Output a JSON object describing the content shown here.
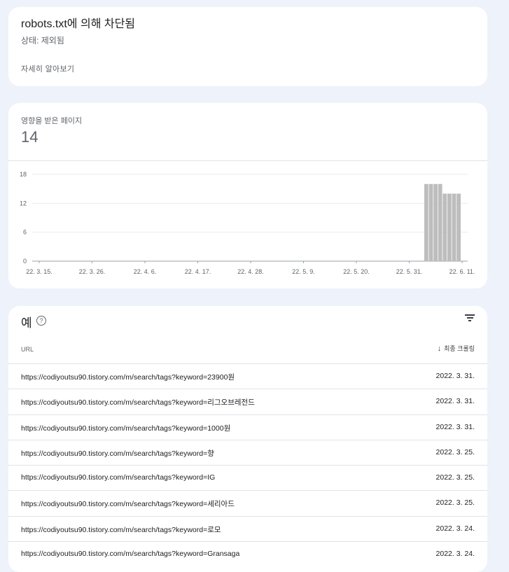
{
  "status_card": {
    "title": "robots.txt에 의해 차단됨",
    "status": "상태: 제외됨",
    "learn_more": "자세히 알아보기"
  },
  "chart_card": {
    "label": "영향을 받은 페이지",
    "count": "14"
  },
  "chart_data": {
    "type": "bar",
    "x_ticks": [
      "22. 3. 15.",
      "22. 3. 26.",
      "22. 4. 6.",
      "22. 4. 17.",
      "22. 4. 28.",
      "22. 5. 9.",
      "22. 5. 20.",
      "22. 5. 31.",
      "22. 6. 11."
    ],
    "y_ticks": [
      0,
      6,
      12,
      18
    ],
    "ylim": [
      0,
      18
    ],
    "bars": [
      {
        "date": "22. 6. 2.",
        "value": 16
      },
      {
        "date": "22. 6. 3.",
        "value": 16
      },
      {
        "date": "22. 6. 4.",
        "value": 16
      },
      {
        "date": "22. 6. 5.",
        "value": 16
      },
      {
        "date": "22. 6. 6.",
        "value": 14
      },
      {
        "date": "22. 6. 7.",
        "value": 14
      },
      {
        "date": "22. 6. 8.",
        "value": 14
      },
      {
        "date": "22. 6. 9.",
        "value": 14
      }
    ],
    "bar_color": "#bdbdbd",
    "grid": true
  },
  "examples": {
    "title": "예",
    "help_icon": "help-icon",
    "filter_icon": "filter-icon",
    "col_url": "URL",
    "col_date": "최종 크롤링",
    "sort_icon": "arrow-down-icon",
    "rows": [
      {
        "url": "https://codiyoutsu90.tistory.com/m/search/tags?keyword=23900원",
        "date": "2022. 3. 31."
      },
      {
        "url": "https://codiyoutsu90.tistory.com/m/search/tags?keyword=리그오브레전드",
        "date": "2022. 3. 31."
      },
      {
        "url": "https://codiyoutsu90.tistory.com/m/search/tags?keyword=1000원",
        "date": "2022. 3. 31."
      },
      {
        "url": "https://codiyoutsu90.tistory.com/m/search/tags?keyword=향",
        "date": "2022. 3. 25."
      },
      {
        "url": "https://codiyoutsu90.tistory.com/m/search/tags?keyword=IG",
        "date": "2022. 3. 25."
      },
      {
        "url": "https://codiyoutsu90.tistory.com/m/search/tags?keyword=세리아드",
        "date": "2022. 3. 25."
      },
      {
        "url": "https://codiyoutsu90.tistory.com/m/search/tags?keyword=로모",
        "date": "2022. 3. 24."
      },
      {
        "url": "https://codiyoutsu90.tistory.com/m/search/tags?keyword=Gransaga",
        "date": "2022. 3. 24."
      }
    ]
  }
}
